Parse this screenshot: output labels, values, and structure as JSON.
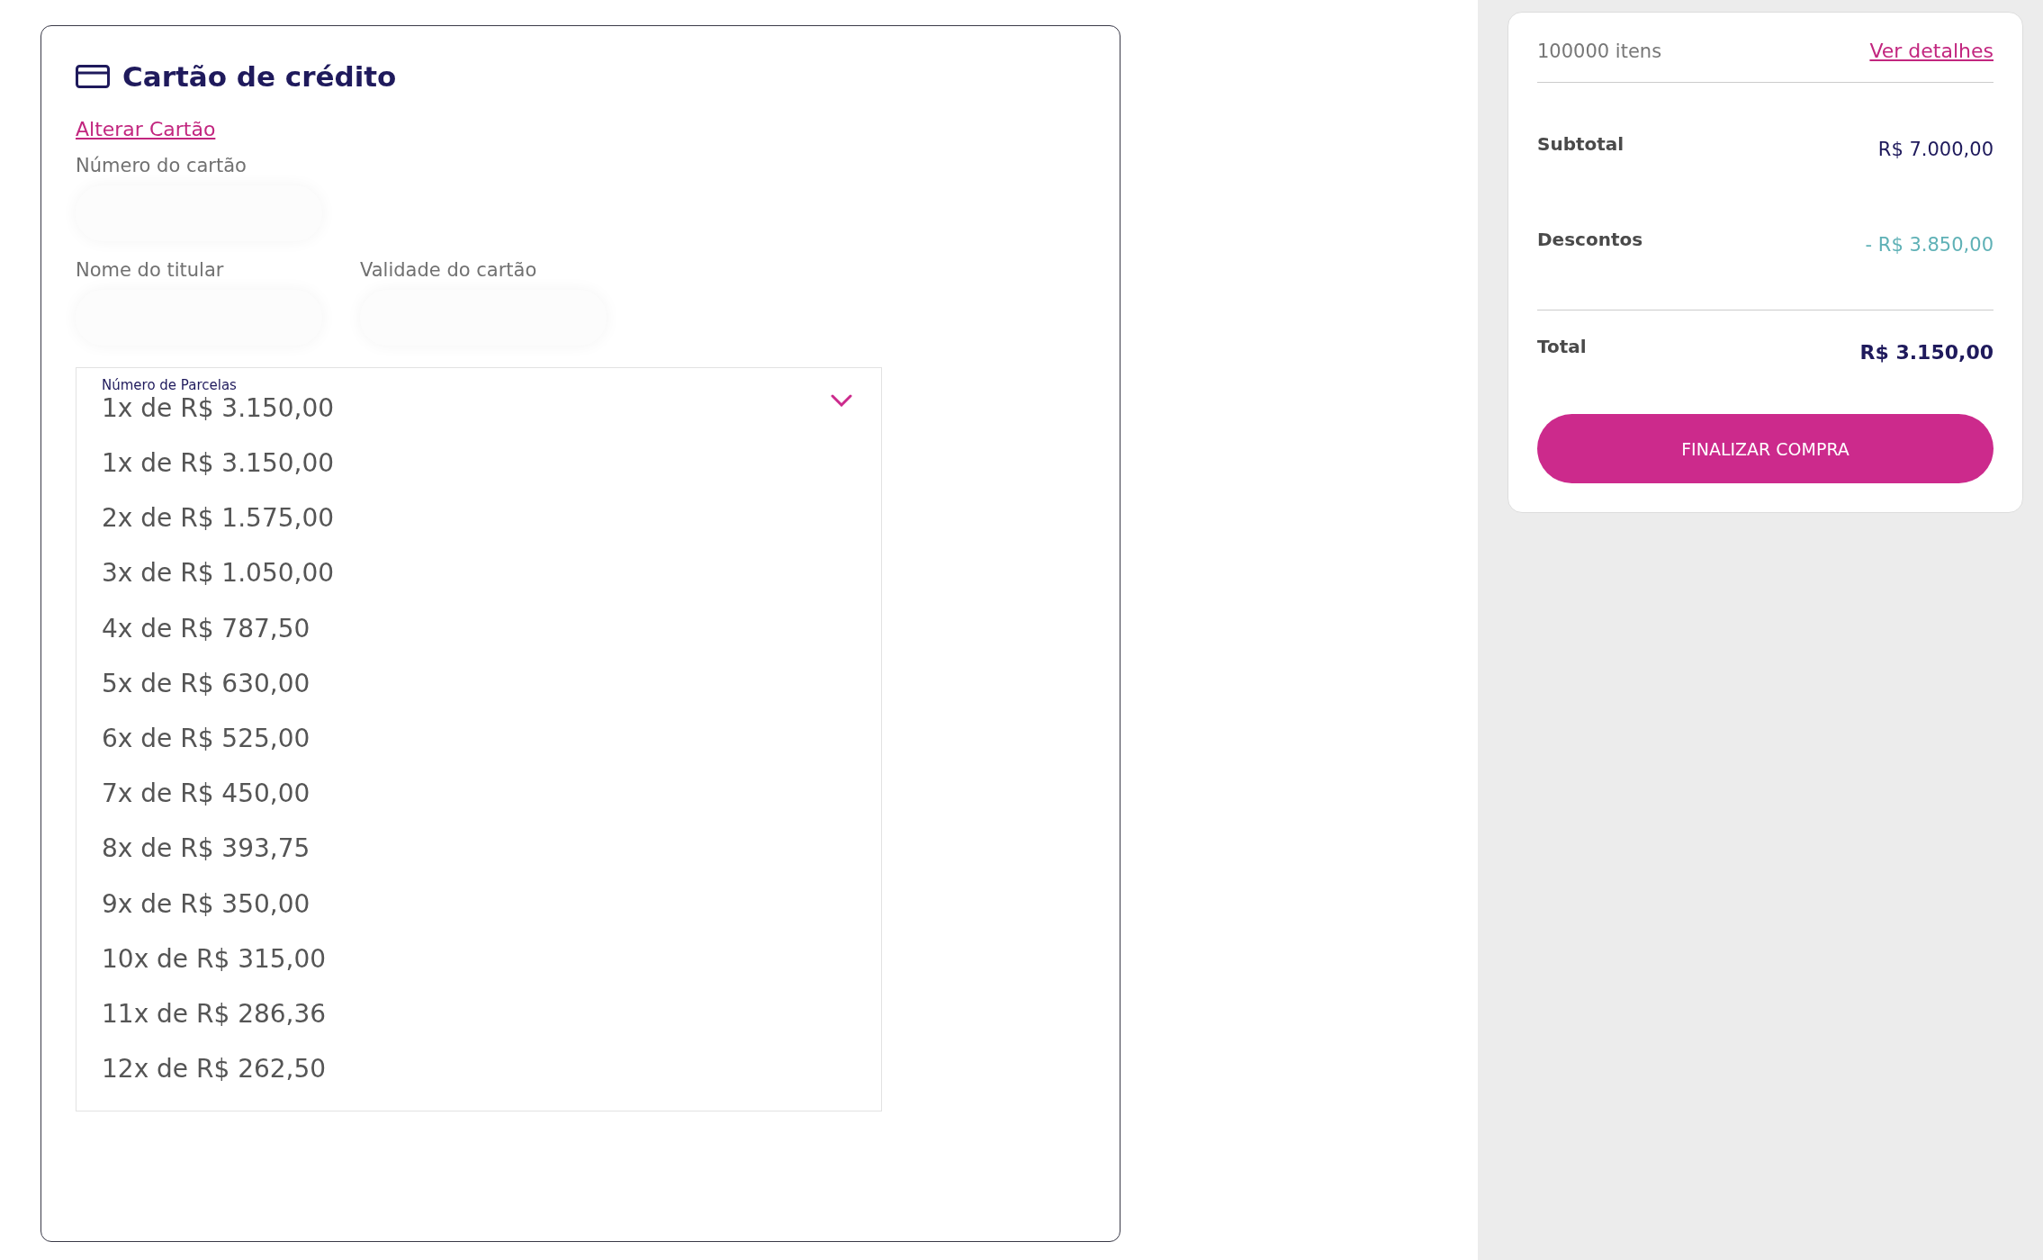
{
  "payment": {
    "title": "Cartão de crédito",
    "change_link": "Alterar Cartão",
    "fields": [
      {
        "label": "Número do cartão"
      },
      {
        "label": "Nome do titular"
      },
      {
        "label": "Validade do cartão"
      }
    ],
    "installments": {
      "label": "Número de Parcelas",
      "value": "1x de R$ 3.150,00",
      "expanded": true,
      "options": [
        "1x de R$ 3.150,00",
        "2x de R$ 1.575,00",
        "3x de R$ 1.050,00",
        "4x de R$ 787,50",
        "5x de R$ 630,00",
        "6x de R$ 525,00",
        "7x de R$ 450,00",
        "8x de R$ 393,75",
        "9x de R$ 350,00",
        "10x de R$ 315,00",
        "11x de R$ 286,36",
        "12x de R$ 262,50"
      ]
    }
  },
  "summary": {
    "items_count": "100000 itens",
    "details_link": "Ver detalhes",
    "lines": [
      {
        "label": "Subtotal",
        "value": "R$ 7.000,00",
        "kind": "plain"
      },
      {
        "label": "Descontos",
        "value": "- R$ 3.850,00",
        "kind": "discount"
      },
      {
        "label": "Total",
        "value": "R$ 3.150,00",
        "kind": "total"
      }
    ],
    "button": "FINALIZAR COMPRA"
  }
}
